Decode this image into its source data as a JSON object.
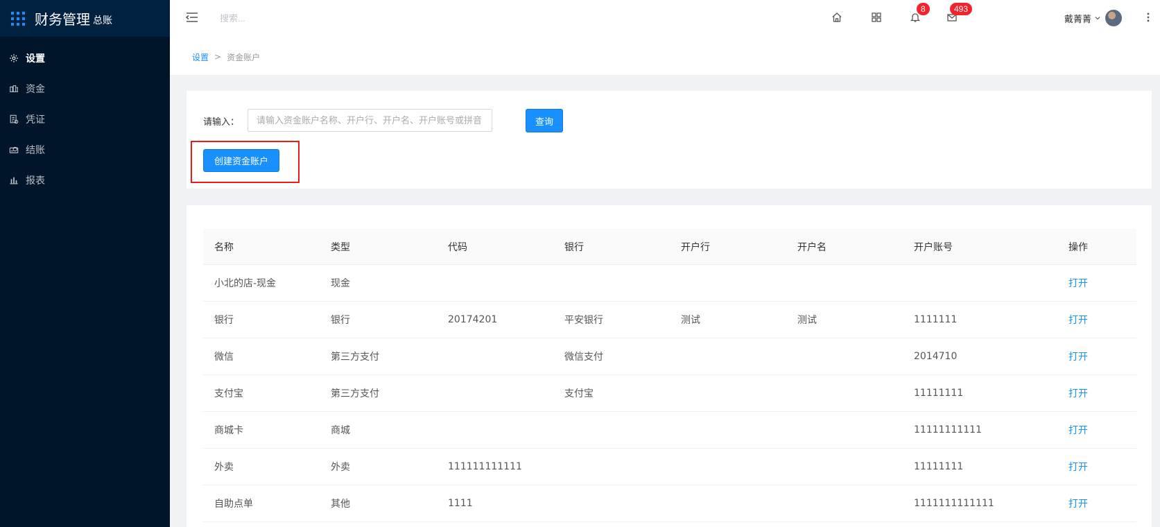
{
  "app": {
    "title": "财务管理",
    "subtitle": "总账"
  },
  "sidebar": {
    "items": [
      {
        "label": "设置",
        "icon": "gear-icon",
        "active": true
      },
      {
        "label": "资金",
        "icon": "money-icon",
        "active": false
      },
      {
        "label": "凭证",
        "icon": "voucher-icon",
        "active": false
      },
      {
        "label": "结账",
        "icon": "checkout-icon",
        "active": false
      },
      {
        "label": "报表",
        "icon": "bar-chart-icon",
        "active": false
      }
    ]
  },
  "header": {
    "search_placeholder": "搜索...",
    "notification_count": "8",
    "message_count": "493",
    "user_name": "戴菁菁"
  },
  "breadcrumb": {
    "root": "设置",
    "separator": ">",
    "current": "资金账户"
  },
  "filter": {
    "label": "请输入：",
    "placeholder": "请输入资金账户名称、开户行、开户名、开户账号或拼音",
    "query_label": "查询",
    "create_label": "创建资金账户"
  },
  "table": {
    "columns": [
      "名称",
      "类型",
      "代码",
      "银行",
      "开户行",
      "开户名",
      "开户账号",
      "操作"
    ],
    "rows": [
      {
        "name": "小北的店-现金",
        "type": "现金",
        "code": "",
        "bank": "",
        "branch": "",
        "holder": "",
        "account": "",
        "action": "打开"
      },
      {
        "name": "银行",
        "type": "银行",
        "code": "20174201",
        "bank": "平安银行",
        "branch": "测试",
        "holder": "测试",
        "account": "1111111",
        "action": "打开"
      },
      {
        "name": "微信",
        "type": "第三方支付",
        "code": "",
        "bank": "微信支付",
        "branch": "",
        "holder": "",
        "account": "2014710",
        "action": "打开"
      },
      {
        "name": "支付宝",
        "type": "第三方支付",
        "code": "",
        "bank": "支付宝",
        "branch": "",
        "holder": "",
        "account": "11111111",
        "action": "打开"
      },
      {
        "name": "商城卡",
        "type": "商城",
        "code": "",
        "bank": "",
        "branch": "",
        "holder": "",
        "account": "11111111111",
        "action": "打开"
      },
      {
        "name": "外卖",
        "type": "外卖",
        "code": "111111111111",
        "bank": "",
        "branch": "",
        "holder": "",
        "account": "11111111",
        "action": "打开"
      },
      {
        "name": "自助点单",
        "type": "其他",
        "code": "1111",
        "bank": "",
        "branch": "",
        "holder": "",
        "account": "1111111111111",
        "action": "打开"
      }
    ]
  },
  "colors": {
    "sidebar_bg": "#001529",
    "primary": "#1890ff",
    "badge": "#f5222d",
    "highlight": "#ee1d1d"
  }
}
